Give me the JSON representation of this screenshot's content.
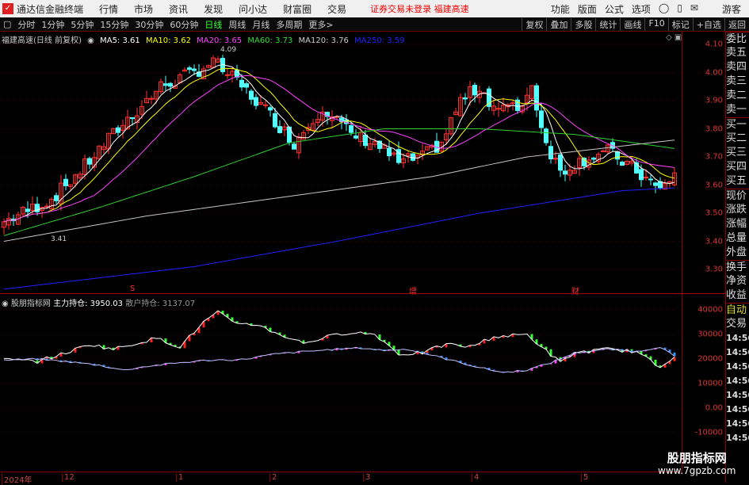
{
  "topbar": {
    "app_title": "通达信金融终端",
    "menus": [
      "行情",
      "市场",
      "资讯",
      "发现",
      "问小达",
      "财富圈",
      "交易"
    ],
    "alert": "证券交易未登录  福建高速",
    "right": [
      "功能",
      "版面",
      "公式",
      "选项",
      "游客"
    ]
  },
  "toolbar": {
    "periods": [
      "分时",
      "1分钟",
      "5分钟",
      "15分钟",
      "30分钟",
      "60分钟",
      "日线",
      "周线",
      "月线",
      "多周期",
      "更多>"
    ],
    "active": "日线",
    "tools": [
      "复权",
      "叠加",
      "多股",
      "统计",
      "画线",
      "F10",
      "标记",
      "+自选",
      "返回"
    ]
  },
  "legend": {
    "title": "福建高速(日线 前复权)",
    "ma5": "MA5: 3.61",
    "ma10": "MA10: 3.62",
    "ma20": "MA20: 3.65",
    "ma60": "MA60: 3.73",
    "ma120": "MA120: 3.76",
    "ma250": "MA250: 3.59",
    "high_label": "4.09",
    "low_label": "3.41"
  },
  "indicator": {
    "name": "股朋指标网",
    "main": "主力持仓: 3950.03",
    "retail": "散户持仓: 3137.07"
  },
  "markers": [
    "S",
    "增",
    "财"
  ],
  "panel": [
    "委比",
    "卖五",
    "卖四",
    "卖三",
    "卖二",
    "卖一",
    "买一",
    "买二",
    "买三",
    "买四",
    "买五",
    "现价",
    "涨跌",
    "涨幅",
    "总量",
    "外盘",
    "换手",
    "净资",
    "收益",
    "自动",
    "交易",
    "14:56",
    "14:56",
    "14:56",
    "14:56",
    "14:56",
    "14:56",
    "14:56",
    "14:56"
  ],
  "dates": [
    "2024年",
    "12",
    "1",
    "2",
    "3",
    "4",
    "5"
  ],
  "watermark": {
    "line1": "股朋指标网",
    "line2": "www.7gpzb.com"
  },
  "colors": {
    "up": "#ff3232",
    "down": "#54ffff",
    "ma5": "#ffffff",
    "ma10": "#ffff00",
    "ma20": "#ff40ff",
    "ma60": "#30d030",
    "ma120": "#c8c8c8",
    "ma250": "#2020ff"
  },
  "chart_data": {
    "type": "candlestick",
    "price_ticks": [
      "4.10",
      "4.00",
      "3.90",
      "3.80",
      "3.70",
      "3.60",
      "3.50",
      "3.40",
      "3.30"
    ],
    "price_range": [
      3.3,
      4.1
    ],
    "close_keypoints": [
      [
        0,
        3.47
      ],
      [
        10,
        3.55
      ],
      [
        16,
        3.65
      ],
      [
        24,
        3.8
      ],
      [
        33,
        3.95
      ],
      [
        40,
        4.0
      ],
      [
        44,
        4.04
      ],
      [
        50,
        3.95
      ],
      [
        56,
        3.85
      ],
      [
        61,
        3.75
      ],
      [
        67,
        3.88
      ],
      [
        73,
        3.78
      ],
      [
        78,
        3.75
      ],
      [
        83,
        3.68
      ],
      [
        88,
        3.7
      ],
      [
        92,
        3.75
      ],
      [
        96,
        3.9
      ],
      [
        100,
        3.95
      ],
      [
        103,
        3.88
      ],
      [
        108,
        3.87
      ],
      [
        111,
        3.95
      ],
      [
        114,
        3.75
      ],
      [
        117,
        3.65
      ],
      [
        123,
        3.7
      ],
      [
        127,
        3.72
      ],
      [
        133,
        3.65
      ],
      [
        138,
        3.58
      ],
      [
        141,
        3.64
      ]
    ],
    "ma60_keypoints": [
      [
        0,
        3.42
      ],
      [
        20,
        3.52
      ],
      [
        40,
        3.63
      ],
      [
        60,
        3.75
      ],
      [
        80,
        3.8
      ],
      [
        100,
        3.8
      ],
      [
        120,
        3.78
      ],
      [
        141,
        3.73
      ]
    ],
    "ma120_keypoints": [
      [
        0,
        3.4
      ],
      [
        30,
        3.49
      ],
      [
        60,
        3.56
      ],
      [
        90,
        3.63
      ],
      [
        110,
        3.7
      ],
      [
        141,
        3.76
      ]
    ],
    "ma250_keypoints": [
      [
        0,
        3.23
      ],
      [
        40,
        3.31
      ],
      [
        70,
        3.4
      ],
      [
        100,
        3.5
      ],
      [
        130,
        3.58
      ],
      [
        141,
        3.59
      ]
    ],
    "indicator_ticks": [
      "40000",
      "30000",
      "20000",
      "10000",
      "0.00",
      "-10000"
    ],
    "indicator_range": [
      -15000,
      45000
    ],
    "main_keypoints": [
      [
        0,
        -500
      ],
      [
        7,
        -2000
      ],
      [
        13,
        5000
      ],
      [
        18,
        12000
      ],
      [
        23,
        8000
      ],
      [
        32,
        17000
      ],
      [
        37,
        10000
      ],
      [
        42,
        30000
      ],
      [
        45,
        38000
      ],
      [
        48,
        30000
      ],
      [
        53,
        28000
      ],
      [
        58,
        20000
      ],
      [
        63,
        13000
      ],
      [
        68,
        18000
      ],
      [
        73,
        22000
      ],
      [
        78,
        20000
      ],
      [
        80,
        14000
      ],
      [
        83,
        4000
      ],
      [
        88,
        5000
      ],
      [
        93,
        12000
      ],
      [
        98,
        10000
      ],
      [
        103,
        18000
      ],
      [
        110,
        20000
      ],
      [
        113,
        10000
      ],
      [
        117,
        -3000
      ],
      [
        120,
        5000
      ],
      [
        127,
        8000
      ],
      [
        133,
        6000
      ],
      [
        138,
        -7000
      ],
      [
        141,
        3000
      ]
    ],
    "retail_keypoints": [
      [
        0,
        -1000
      ],
      [
        7,
        0
      ],
      [
        13,
        -2000
      ],
      [
        20,
        -5000
      ],
      [
        25,
        -9000
      ],
      [
        30,
        -6000
      ],
      [
        37,
        -3000
      ],
      [
        43,
        -1000
      ],
      [
        50,
        -500
      ],
      [
        57,
        4000
      ],
      [
        63,
        6000
      ],
      [
        70,
        8000
      ],
      [
        75,
        9000
      ],
      [
        80,
        7000
      ],
      [
        85,
        8000
      ],
      [
        90,
        3000
      ],
      [
        95,
        -2000
      ],
      [
        100,
        -7000
      ],
      [
        105,
        -11000
      ],
      [
        110,
        -9000
      ],
      [
        115,
        -3000
      ],
      [
        120,
        5000
      ],
      [
        127,
        8000
      ],
      [
        133,
        6000
      ],
      [
        138,
        10000
      ],
      [
        141,
        2000
      ]
    ]
  }
}
